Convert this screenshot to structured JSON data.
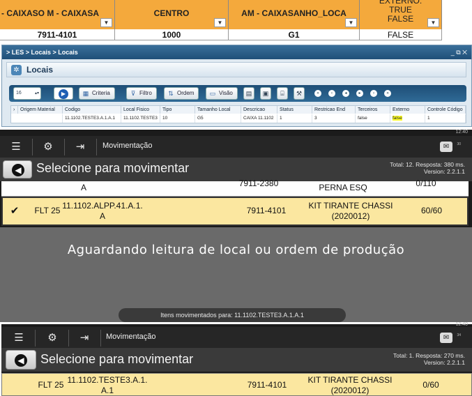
{
  "spreadsheet": {
    "headers": [
      "- CAIXASO M - CAIXASA",
      "CENTRO",
      "AM - CAIXASANHO_LOCA",
      "EXTERNO:\nTRUE\nFALSE"
    ],
    "row": [
      "7911-4101",
      "1000",
      "G1",
      "FALSE"
    ]
  },
  "les": {
    "breadcrumb": "> LES > Locais > Locais",
    "window_buttons": "_ ⧉ ✕",
    "header_title": "Locais",
    "page_size": "16",
    "toolbar": {
      "criteria": "Criteria",
      "filtro": "Filtro",
      "ordem": "Ordem",
      "visao": "Visão"
    },
    "columns": [
      "Origem Material",
      "Codigo",
      "Local Fisico",
      "Tipo",
      "Tamanho Local",
      "Descricao",
      "Status",
      "Restricao End",
      "Terceiros",
      "Externo",
      "Controle Código"
    ],
    "row": [
      "",
      "11.1102.TESTE3.A.1.A.1",
      "11.1102.TESTE3",
      "10",
      "G5",
      "CAIXA 11.1102",
      "1",
      "3",
      "false",
      "false",
      "1"
    ]
  },
  "app1": {
    "status_time": "12:40",
    "title": "Movimentação",
    "mail_count": "30",
    "subtitle": "Selecione para movimentar",
    "total_line": "Total: 12. Resposta: 380 ms.",
    "version_line": "Version: 2.2.1.1",
    "partial_row": {
      "code": "A",
      "material": "7911-2380",
      "desc": "PERNA ESQ",
      "qty": "0/110"
    },
    "selected_row": {
      "check": "✔",
      "location": "FLT 25",
      "code": "11.1102.ALPP.41.A.1.\nA",
      "material": "7911-4101",
      "desc": "KIT TIRANTE CHASSI\n(2020012)",
      "qty": "60/60"
    },
    "waiting_message": "Aguardando leitura de local ou ordem de produção",
    "toast": "Itens movimentados para: 11.1102.TESTE3.A.1.A.1"
  },
  "app2": {
    "status_time": "12:40",
    "title": "Movimentação",
    "mail_count": "34",
    "subtitle": "Selecione para movimentar",
    "total_line": "Total: 1. Resposta: 270 ms.",
    "version_line": "Version: 2.2.1.1",
    "row": {
      "location": "FLT 25",
      "code": "11.1102.TESTE3.A.1.\nA.1",
      "material": "7911-4101",
      "desc": "KIT TIRANTE CHASSI\n(2020012)",
      "qty": "0/60"
    }
  }
}
